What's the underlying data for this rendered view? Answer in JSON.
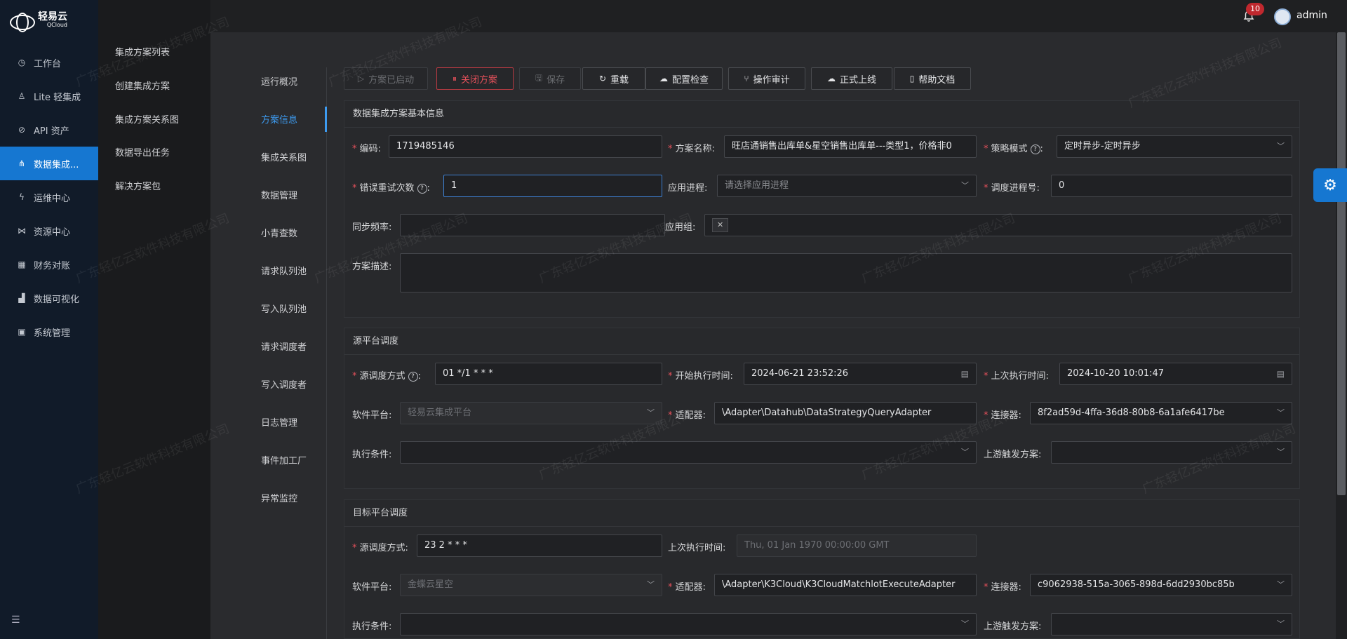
{
  "brand": {
    "name": "轻易云",
    "sub": "QCloud"
  },
  "nav": [
    {
      "label": "工作台",
      "icon": "clock-icon"
    },
    {
      "label": "Lite 轻集成",
      "icon": "lamp-icon"
    },
    {
      "label": "API 资产",
      "icon": "compass-icon"
    },
    {
      "label": "数据集成...",
      "icon": "nodes-icon",
      "active": true
    },
    {
      "label": "运维中心",
      "icon": "bolt-icon"
    },
    {
      "label": "资源中心",
      "icon": "network-icon"
    },
    {
      "label": "财务对账",
      "icon": "calculator-icon"
    },
    {
      "label": "数据可视化",
      "icon": "bar-chart-icon"
    },
    {
      "label": "系统管理",
      "icon": "grid-icon"
    }
  ],
  "submenu": [
    "集成方案列表",
    "创建集成方案",
    "集成方案关系图",
    "数据导出任务",
    "解决方案包"
  ],
  "header": {
    "badge": "10",
    "user": "admin"
  },
  "tabs": [
    "运行概况",
    "方案信息",
    "集成关系图",
    "数据管理",
    "小青查数",
    "请求队列池",
    "写入队列池",
    "请求调度者",
    "写入调度者",
    "日志管理",
    "事件加工厂",
    "异常监控"
  ],
  "toolbar": [
    "方案已启动",
    "关闭方案",
    "保存",
    "重载",
    "配置检查",
    "操作审计",
    "正式上线",
    "帮助文档"
  ],
  "watermark": "广东轻亿云软件科技有限公司",
  "basic": {
    "title": "数据集成方案基本信息",
    "code_label": "编码:",
    "code": "1719485146",
    "name_label": "方案名称:",
    "name": "旺店通销售出库单&星空销售出库单---类型1，价格非0",
    "strategy_label": "策略模式",
    "strategy": "定时异步-定时异步",
    "retry_label": "错误重试次数",
    "retry": "1",
    "process_label": "应用进程:",
    "process_ph": "请选择应用进程",
    "sched_label": "调度进程号:",
    "sched": "0",
    "freq_label": "同步频率:",
    "group_label": "应用组:",
    "desc_label": "方案描述:"
  },
  "source": {
    "title": "源平台调度",
    "mode_label": "源调度方式",
    "mode": "01 */1 * * *",
    "start_label": "开始执行时间:",
    "start": "2024-06-21 23:52:26",
    "last_label": "上次执行时间:",
    "last": "2024-10-20 10:01:47",
    "platform_label": "软件平台:",
    "platform": "轻易云集成平台",
    "adapter_label": "适配器:",
    "adapter": "\\Adapter\\Datahub\\DataStrategyQueryAdapter",
    "connector_label": "连接器:",
    "connector": "8f2ad59d-4ffa-36d8-80b8-6a1afe6417be",
    "cond_label": "执行条件:",
    "trigger_label": "上游触发方案:"
  },
  "target": {
    "title": "目标平台调度",
    "mode_label": "源调度方式:",
    "mode": "23 2 * * *",
    "last_label": "上次执行时间:",
    "last": "Thu, 01 Jan 1970 00:00:00 GMT",
    "platform_label": "软件平台:",
    "platform": "金蝶云星空",
    "adapter_label": "适配器:",
    "adapter": "\\Adapter\\K3Cloud\\K3CloudMatchlotExecuteAdapter",
    "connector_label": "连接器:",
    "connector": "c9062938-515a-3065-898d-6dd2930bc85b",
    "cond_label": "执行条件:",
    "trigger_label": "上游触发方案:"
  }
}
